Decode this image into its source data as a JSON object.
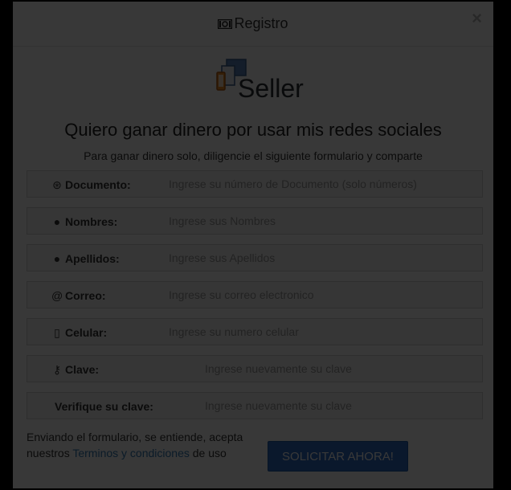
{
  "modal": {
    "title": "Registro",
    "close_label": "×"
  },
  "logo": {
    "text": "Seller"
  },
  "headline": "Quiero ganar dinero por usar mis redes sociales",
  "subline": "Para ganar dinero solo, diligencie el siguiente formulario y comparte",
  "fields": [
    {
      "label": "Documento:",
      "placeholder": "Ingrese su número de Documento (solo números)"
    },
    {
      "label": "Nombres:",
      "placeholder": "Ingrese sus Nombres"
    },
    {
      "label": "Apellidos:",
      "placeholder": "Ingrese sus Apellidos"
    },
    {
      "label": "Correo:",
      "placeholder": "Ingrese su correo electronico"
    },
    {
      "label": "Celular:",
      "placeholder": "Ingrese su numero celular"
    },
    {
      "label": "Clave:",
      "placeholder": "Ingrese nuevamente su clave"
    },
    {
      "label": "Verifique su clave:",
      "placeholder": "Ingrese nuevamente su clave"
    }
  ],
  "terms": {
    "text_before": "Enviando el formulario, se entiende, acepta nuestros ",
    "link": "Terminos y condiciones",
    "text_after": " de uso"
  },
  "submit_label": "SOLICITAR AHORA!",
  "colors": {
    "accent": "#2f6fc8",
    "link": "#337ab7"
  }
}
